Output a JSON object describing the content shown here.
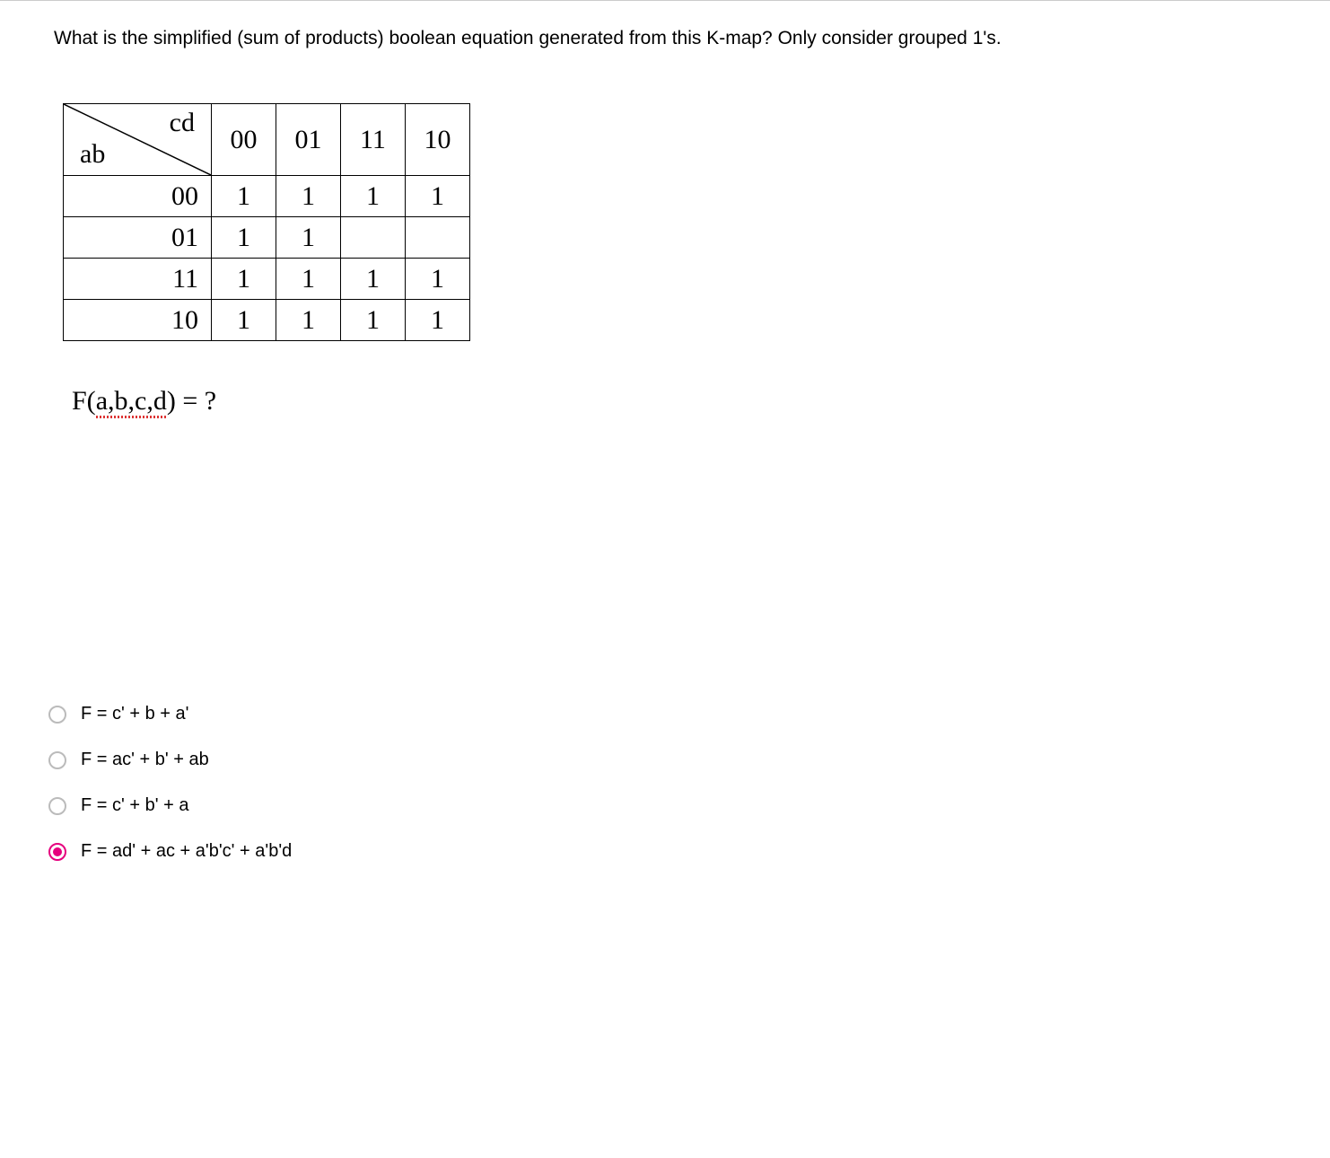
{
  "question": "What is the simplified (sum of products) boolean equation generated from this K-map? Only consider grouped 1's.",
  "kmap": {
    "col_var": "cd",
    "row_var": "ab",
    "col_headers": [
      "00",
      "01",
      "11",
      "10"
    ],
    "row_headers": [
      "00",
      "01",
      "11",
      "10"
    ],
    "cells": [
      [
        "1",
        "1",
        "1",
        "1"
      ],
      [
        "1",
        "1",
        "",
        ""
      ],
      [
        "1",
        "1",
        "1",
        "1"
      ],
      [
        "1",
        "1",
        "1",
        "1"
      ]
    ]
  },
  "function_label": "F(a,b,c,d) = ?",
  "function_prefix": "F(",
  "function_args": "a,b,c,d",
  "function_suffix": ") = ?",
  "options": [
    {
      "label": "F =  c' + b + a'",
      "selected": false
    },
    {
      "label": "F =  ac' + b' + ab",
      "selected": false
    },
    {
      "label": "F =  c' + b' + a",
      "selected": false
    },
    {
      "label": "F =  ad' + ac + a'b'c' + a'b'd",
      "selected": true
    }
  ]
}
